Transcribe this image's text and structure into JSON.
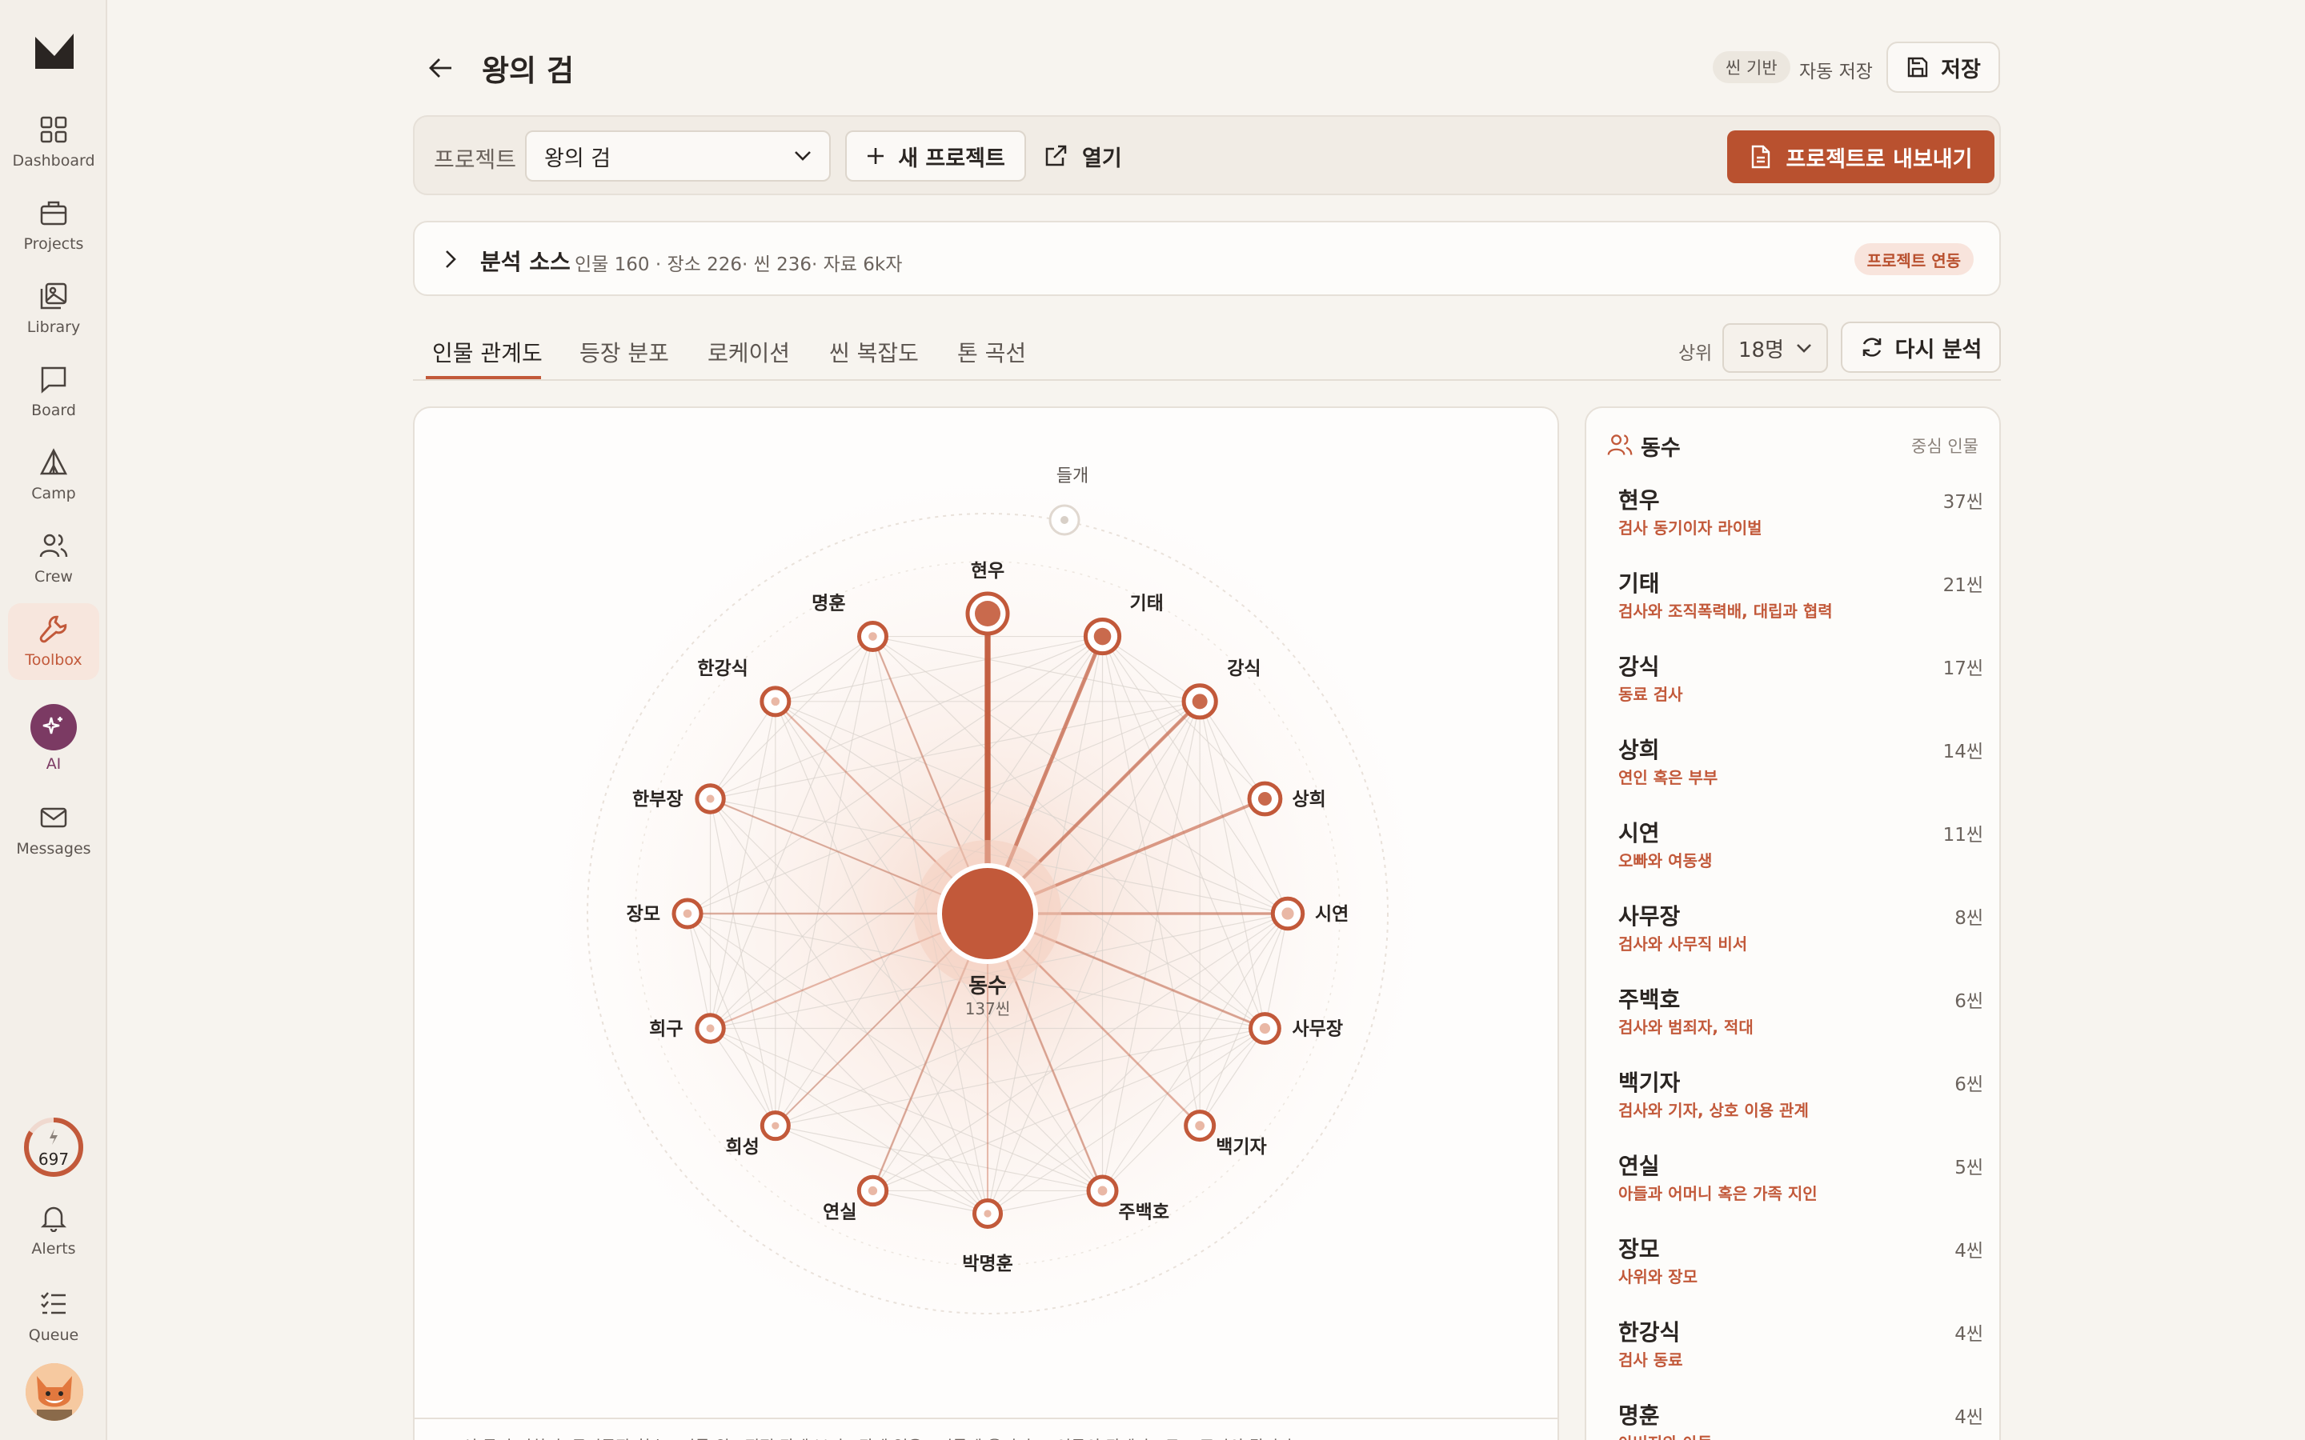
{
  "sidebar": {
    "items": [
      {
        "label": "Dashboard",
        "icon": "grid-icon"
      },
      {
        "label": "Projects",
        "icon": "briefcase-icon"
      },
      {
        "label": "Library",
        "icon": "images-icon"
      },
      {
        "label": "Board",
        "icon": "chat-icon"
      },
      {
        "label": "Camp",
        "icon": "tent-icon"
      },
      {
        "label": "Crew",
        "icon": "users-icon"
      },
      {
        "label": "Toolbox",
        "icon": "wrench-icon",
        "active": true
      },
      {
        "label": "AI",
        "icon": "sparkle-icon"
      },
      {
        "label": "Messages",
        "icon": "mail-icon"
      }
    ],
    "credits": "697",
    "bottom": [
      {
        "label": "Alerts",
        "icon": "bell-icon"
      },
      {
        "label": "Queue",
        "icon": "checklist-icon"
      }
    ]
  },
  "header": {
    "title": "왕의 검",
    "mode_badge": "씬 기반",
    "autosave": "자동 저장",
    "save_label": "저장"
  },
  "project_bar": {
    "label": "프로젝트",
    "selected": "왕의 검",
    "new_project": "새 프로젝트",
    "open": "열기",
    "export": "프로젝트로 내보내기"
  },
  "source": {
    "title": "분석 소스",
    "stats": "인물 160 · 장소 226· 씬 236· 자료 6k자",
    "badge": "프로젝트 연동"
  },
  "tabs": [
    "인물 관계도",
    "등장 분포",
    "로케이션",
    "씬 복잡도",
    "톤 곡선"
  ],
  "controls": {
    "top_label": "상위",
    "top_value": "18명",
    "reanalyze": "다시 분석"
  },
  "graph": {
    "center": {
      "name": "동수",
      "scenes": "137씬"
    },
    "nodes": [
      {
        "name": "현우",
        "weight": 37
      },
      {
        "name": "기태",
        "weight": 21
      },
      {
        "name": "강식",
        "weight": 17
      },
      {
        "name": "상희",
        "weight": 14
      },
      {
        "name": "시연",
        "weight": 11
      },
      {
        "name": "사무장",
        "weight": 8
      },
      {
        "name": "백기자",
        "weight": 6
      },
      {
        "name": "주백호",
        "weight": 6
      },
      {
        "name": "박명훈",
        "weight": 2
      },
      {
        "name": "연실",
        "weight": 5
      },
      {
        "name": "희성",
        "weight": 2
      },
      {
        "name": "희구",
        "weight": 3
      },
      {
        "name": "장모",
        "weight": 4
      },
      {
        "name": "한부장",
        "weight": 3
      },
      {
        "name": "한강식",
        "weight": 4
      },
      {
        "name": "명훈",
        "weight": 4
      }
    ],
    "outer_node": "들개",
    "footer_note": "선 굵기 진하기: 동시등장 횟수 · 이름 위 · 직접 관계 보기 · 관계 없음 · 이름에 올리면 그 인물의 관계만 · 구조 주시의 됩니다"
  },
  "relations": {
    "title": "동수",
    "subtitle": "중심 인물",
    "items": [
      {
        "name": "현우",
        "scenes": "37씬",
        "desc": "검사 동기이자 라이벌"
      },
      {
        "name": "기태",
        "scenes": "21씬",
        "desc": "검사와 조직폭력배, 대립과 협력"
      },
      {
        "name": "강식",
        "scenes": "17씬",
        "desc": "동료 검사"
      },
      {
        "name": "상희",
        "scenes": "14씬",
        "desc": "연인 혹은 부부"
      },
      {
        "name": "시연",
        "scenes": "11씬",
        "desc": "오빠와 여동생"
      },
      {
        "name": "사무장",
        "scenes": "8씬",
        "desc": "검사와 사무직 비서"
      },
      {
        "name": "주백호",
        "scenes": "6씬",
        "desc": "검사와 범죄자, 적대"
      },
      {
        "name": "백기자",
        "scenes": "6씬",
        "desc": "검사와 기자, 상호 이용 관계"
      },
      {
        "name": "연실",
        "scenes": "5씬",
        "desc": "아들과 어머니 혹은 가족 지인"
      },
      {
        "name": "장모",
        "scenes": "4씬",
        "desc": "사위와 장모"
      },
      {
        "name": "한강식",
        "scenes": "4씬",
        "desc": "검사 동료"
      },
      {
        "name": "명훈",
        "scenes": "4씬",
        "desc": "아버지와 아들"
      }
    ]
  },
  "colors": {
    "accent": "#c2593a",
    "export": "#b9512f",
    "ai": "#7b3a63"
  }
}
